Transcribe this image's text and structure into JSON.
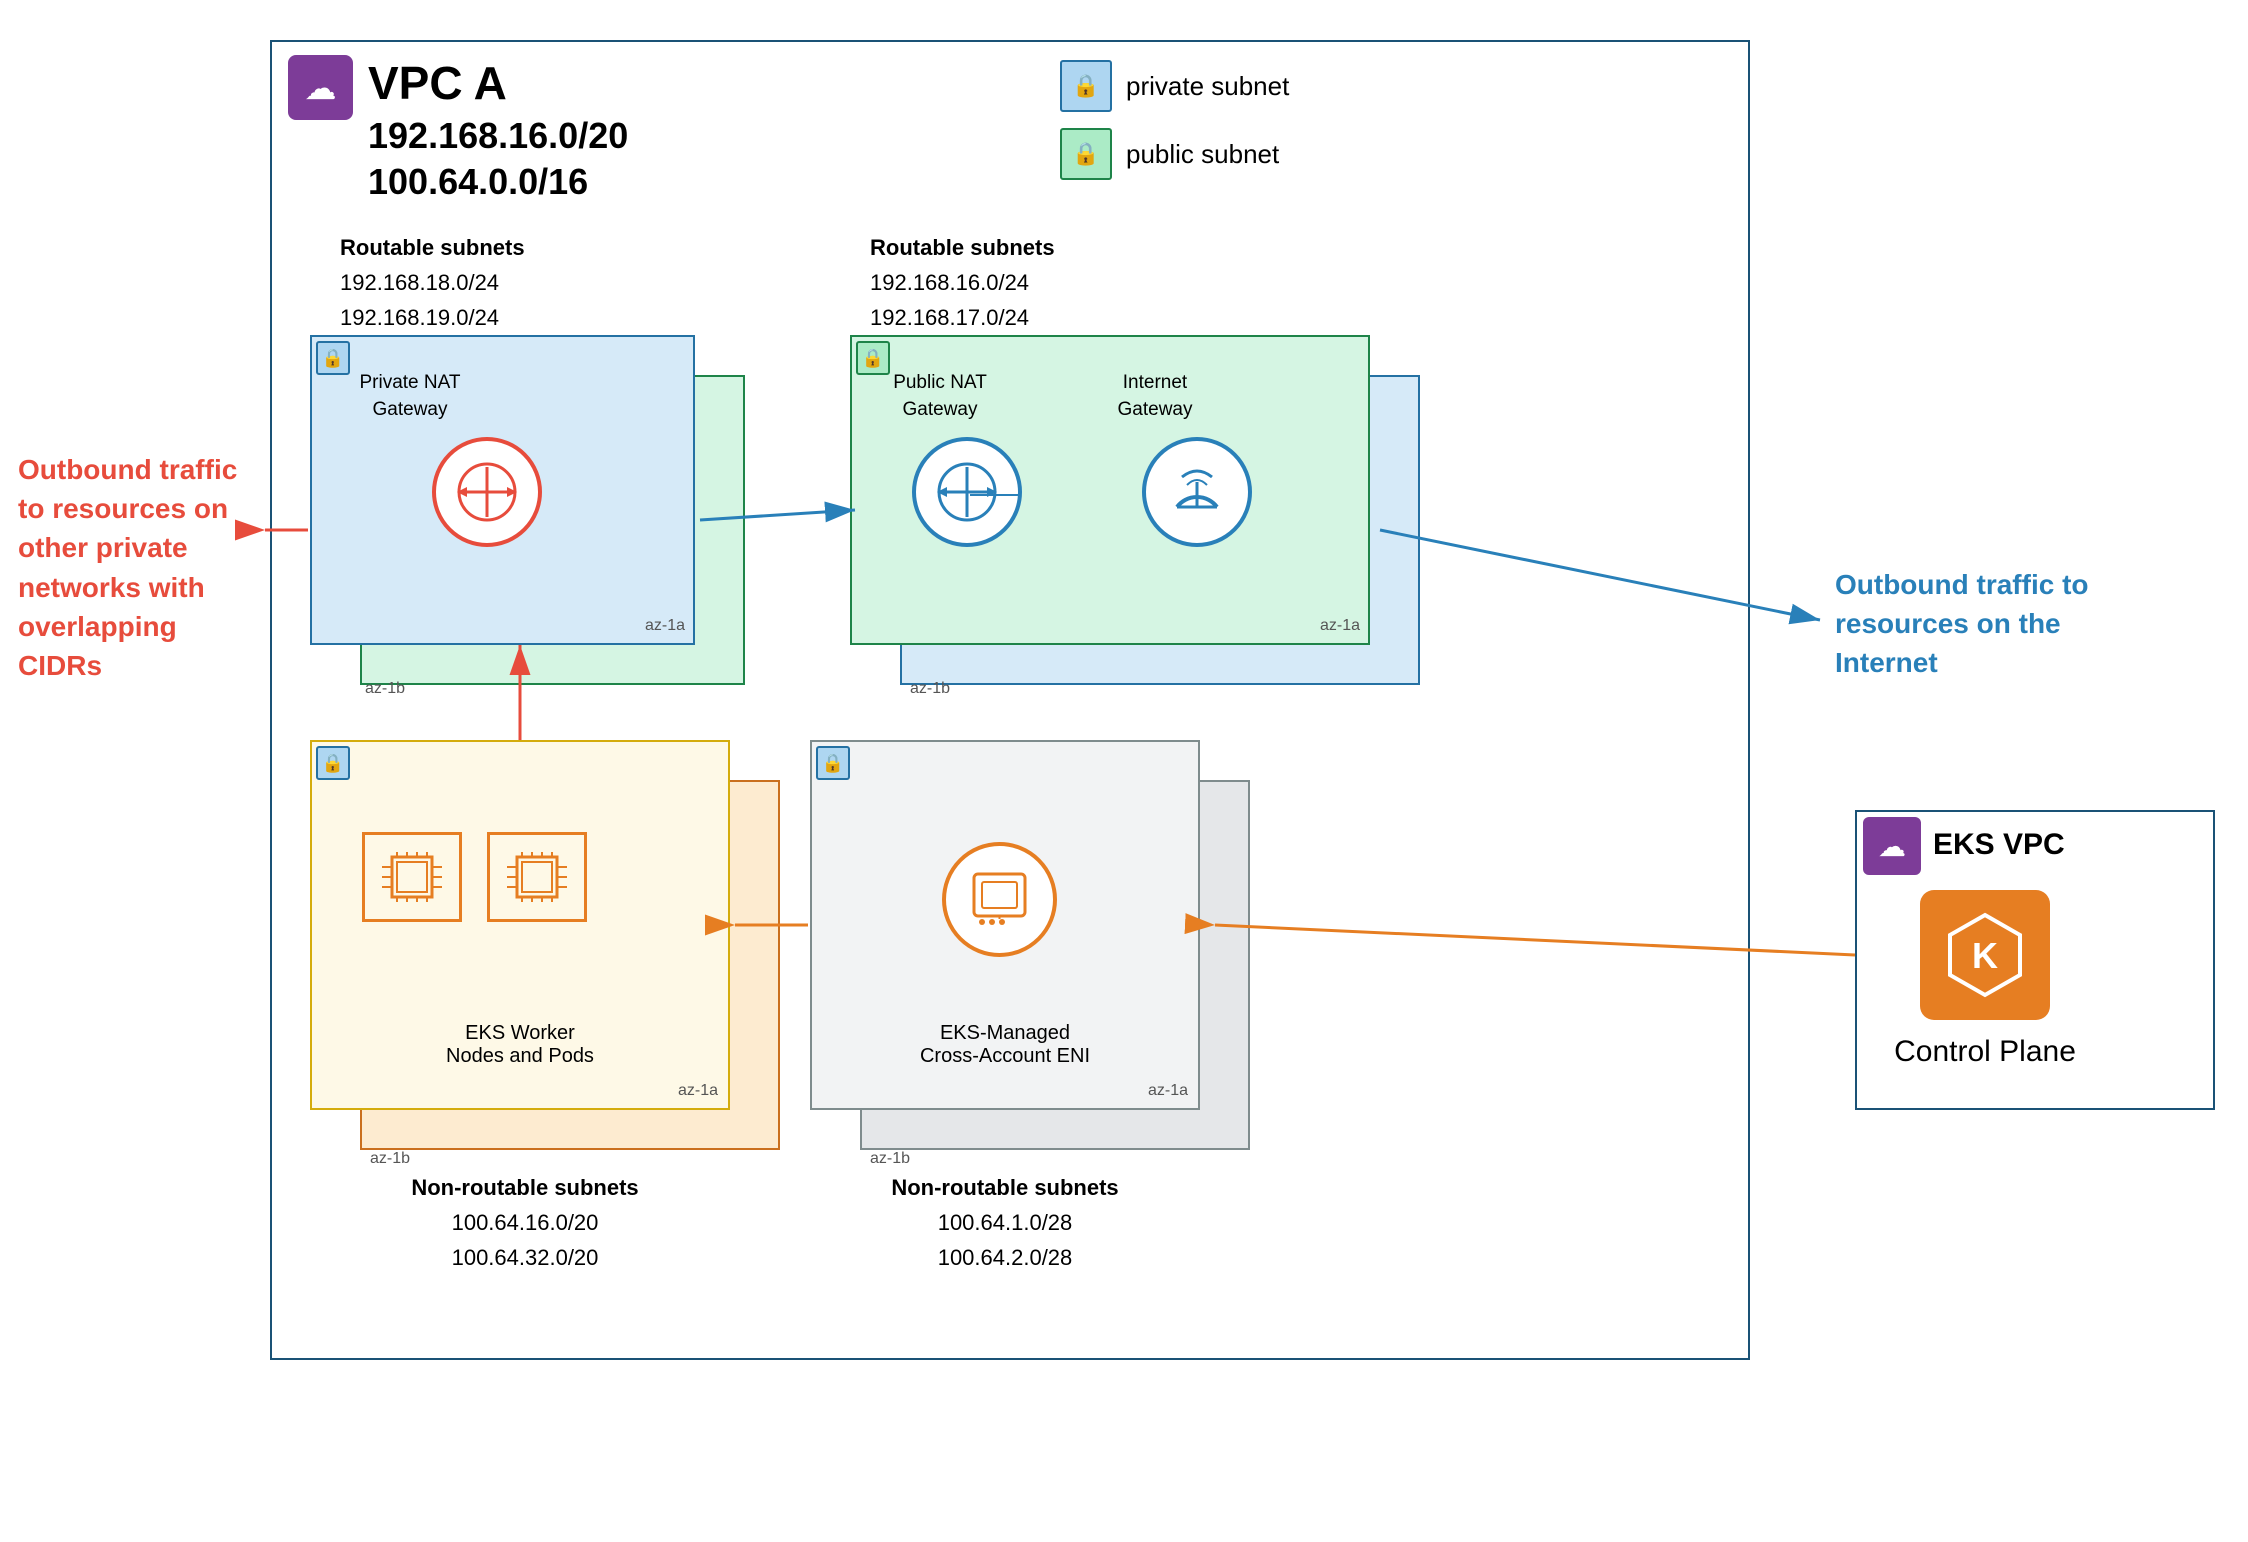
{
  "vpc_a": {
    "title": "VPC A",
    "cidr1": "192.168.16.0/20",
    "cidr2": "100.64.0.0/16",
    "icon": "☁"
  },
  "legend": {
    "private_label": "private subnet",
    "public_label": "public subnet"
  },
  "routable_left": {
    "title": "Routable subnets",
    "cidr1": "192.168.18.0/24",
    "cidr2": "192.168.19.0/24"
  },
  "routable_right": {
    "title": "Routable subnets",
    "cidr1": "192.168.16.0/24",
    "cidr2": "192.168.17.0/24"
  },
  "private_nat": {
    "label1": "Private NAT",
    "label2": "Gateway",
    "az_inner": "az-1a",
    "az_outer": "az-1b"
  },
  "public_nat": {
    "label1": "Public NAT",
    "label2": "Gateway",
    "az_inner": "az-1a",
    "az_outer": "az-1b"
  },
  "internet_gw": {
    "label1": "Internet",
    "label2": "Gateway",
    "az_inner": "az-1a",
    "az_outer": "az-1b"
  },
  "eks_workers": {
    "label1": "EKS Worker",
    "label2": "Nodes and Pods",
    "az_inner": "az-1a",
    "az_outer": "az-1b"
  },
  "eks_eni": {
    "label1": "EKS-Managed",
    "label2": "Cross-Account ENI",
    "az_inner": "az-1a",
    "az_outer": "az-1b"
  },
  "non_routable_left": {
    "title": "Non-routable subnets",
    "cidr1": "100.64.16.0/20",
    "cidr2": "100.64.32.0/20"
  },
  "non_routable_right": {
    "title": "Non-routable subnets",
    "cidr1": "100.64.1.0/28",
    "cidr2": "100.64.2.0/28"
  },
  "outbound_left": {
    "text": "Outbound traffic to resources on other private networks with overlapping CIDRs"
  },
  "outbound_right": {
    "text": "Outbound traffic to resources on the Internet"
  },
  "eks_vpc": {
    "title": "EKS VPC",
    "icon": "☁"
  },
  "control_plane": {
    "label": "Control Plane"
  },
  "colors": {
    "private_blue": "#2471a3",
    "private_bg": "#d6eaf8",
    "public_green": "#1e8449",
    "public_bg": "#d5f5e3",
    "yellow_bg": "#fef9e7",
    "orange_border": "#ca6f1e",
    "gray_bg": "#f2f3f4",
    "red_arrow": "#e74c3c",
    "blue_arrow": "#2980b9",
    "orange_arrow": "#e67e22",
    "purple": "#7d3c98"
  }
}
